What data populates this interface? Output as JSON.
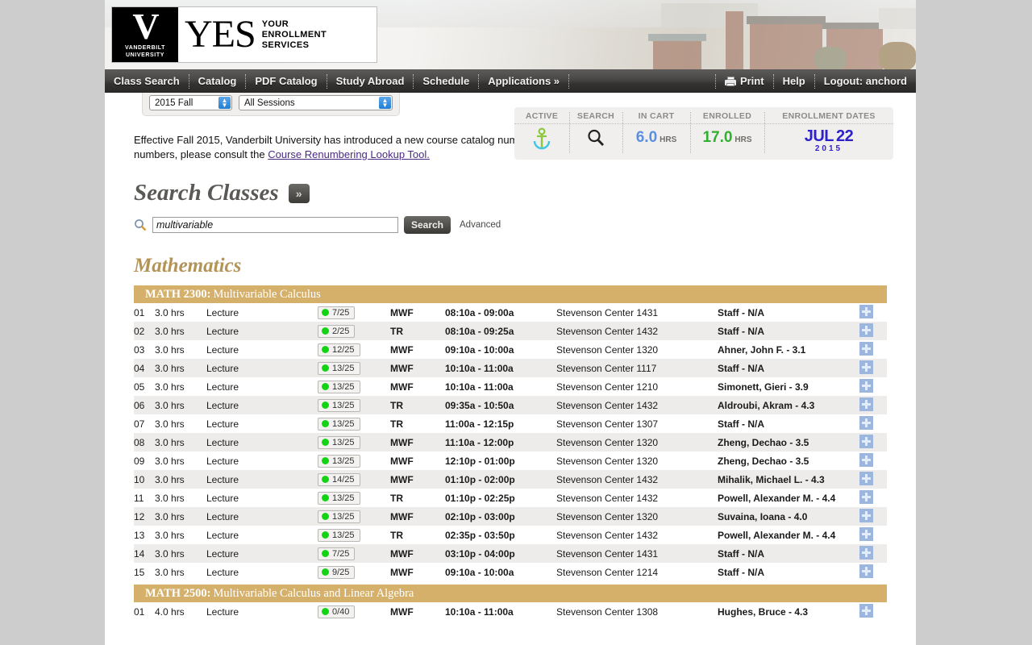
{
  "brand": {
    "university_line1": "VANDERBILT",
    "university_line2": "UNIVERSITY",
    "yes": "YES",
    "tagline_1": "YOUR",
    "tagline_2": "ENROLLMENT",
    "tagline_3": "SERVICES"
  },
  "nav": {
    "left_items": [
      "Class Search",
      "Catalog",
      "PDF Catalog",
      "Study Abroad",
      "Schedule",
      "Applications »"
    ],
    "print": "Print",
    "help": "Help",
    "logout": "Logout: anchord"
  },
  "term_bar": {
    "term": "2015 Fall",
    "session": "All Sessions"
  },
  "status": {
    "active_label": "ACTIVE",
    "search_label": "SEARCH",
    "cart_label": "IN CART",
    "cart_value": "6.0",
    "cart_units": "HRS",
    "cart_color": "#5b8fe0",
    "enrolled_label": "ENROLLED",
    "enrolled_value": "17.0",
    "enrolled_units": "HRS",
    "enrolled_color": "#2fb02f",
    "dates_label": "ENROLLMENT DATES",
    "dates_month": "JUL",
    "dates_day": "22",
    "dates_year": "2015"
  },
  "notice": {
    "text_before": "Effective Fall 2015, Vanderbilt University has introduced a new course catalog numbering scheme. For assistance with the translation between old and new numbers, please consult the ",
    "link": "Course Renumbering Lookup Tool."
  },
  "search": {
    "heading": "Search Classes",
    "expand_button": "»",
    "input_value": "multivariable",
    "button_label": "Search",
    "advanced_label": "Advanced"
  },
  "department": "Mathematics",
  "courses": [
    {
      "code": "MATH 2300:",
      "title": "Multivariable Calculus",
      "sections": [
        {
          "sec": "01",
          "hrs": "3.0 hrs",
          "type": "Lecture",
          "avail": "7/25",
          "days": "MWF",
          "time": "08:10a - 09:00a",
          "loc": "Stevenson Center 1431",
          "instructor": "Staff - N/A",
          "rating_color": "dark"
        },
        {
          "sec": "02",
          "hrs": "3.0 hrs",
          "type": "Lecture",
          "avail": "2/25",
          "days": "TR",
          "time": "08:10a - 09:25a",
          "loc": "Stevenson Center 1432",
          "instructor": "Staff - N/A",
          "rating_color": "dark"
        },
        {
          "sec": "03",
          "hrs": "3.0 hrs",
          "type": "Lecture",
          "avail": "12/25",
          "days": "MWF",
          "time": "09:10a - 10:00a",
          "loc": "Stevenson Center 1320",
          "instructor": "Ahner, John F. - 3.1",
          "rating_color": "orange"
        },
        {
          "sec": "04",
          "hrs": "3.0 hrs",
          "type": "Lecture",
          "avail": "13/25",
          "days": "MWF",
          "time": "10:10a - 11:00a",
          "loc": "Stevenson Center 1117",
          "instructor": "Staff - N/A",
          "rating_color": "dark"
        },
        {
          "sec": "05",
          "hrs": "3.0 hrs",
          "type": "Lecture",
          "avail": "13/25",
          "days": "MWF",
          "time": "10:10a - 11:00a",
          "loc": "Stevenson Center 1210",
          "instructor": "Simonett, Gieri - 3.9",
          "rating_color": "orange"
        },
        {
          "sec": "06",
          "hrs": "3.0 hrs",
          "type": "Lecture",
          "avail": "13/25",
          "days": "TR",
          "time": "09:35a - 10:50a",
          "loc": "Stevenson Center 1432",
          "instructor": "Aldroubi, Akram - 4.3",
          "rating_color": "green"
        },
        {
          "sec": "07",
          "hrs": "3.0 hrs",
          "type": "Lecture",
          "avail": "13/25",
          "days": "TR",
          "time": "11:00a - 12:15p",
          "loc": "Stevenson Center 1307",
          "instructor": "Staff - N/A",
          "rating_color": "dark"
        },
        {
          "sec": "08",
          "hrs": "3.0 hrs",
          "type": "Lecture",
          "avail": "13/25",
          "days": "MWF",
          "time": "11:10a - 12:00p",
          "loc": "Stevenson Center 1320",
          "instructor": "Zheng, Dechao - 3.5",
          "rating_color": "orange"
        },
        {
          "sec": "09",
          "hrs": "3.0 hrs",
          "type": "Lecture",
          "avail": "13/25",
          "days": "MWF",
          "time": "12:10p - 01:00p",
          "loc": "Stevenson Center 1320",
          "instructor": "Zheng, Dechao - 3.5",
          "rating_color": "orange"
        },
        {
          "sec": "10",
          "hrs": "3.0 hrs",
          "type": "Lecture",
          "avail": "14/25",
          "days": "MWF",
          "time": "01:10p - 02:00p",
          "loc": "Stevenson Center 1432",
          "instructor": "Mihalik, Michael L. - 4.3",
          "rating_color": "green"
        },
        {
          "sec": "11",
          "hrs": "3.0 hrs",
          "type": "Lecture",
          "avail": "13/25",
          "days": "TR",
          "time": "01:10p - 02:25p",
          "loc": "Stevenson Center 1432",
          "instructor": "Powell, Alexander M. - 4.4",
          "rating_color": "green"
        },
        {
          "sec": "12",
          "hrs": "3.0 hrs",
          "type": "Lecture",
          "avail": "13/25",
          "days": "MWF",
          "time": "02:10p - 03:00p",
          "loc": "Stevenson Center 1320",
          "instructor": "Suvaina, Ioana - 4.0",
          "rating_color": "green"
        },
        {
          "sec": "13",
          "hrs": "3.0 hrs",
          "type": "Lecture",
          "avail": "13/25",
          "days": "TR",
          "time": "02:35p - 03:50p",
          "loc": "Stevenson Center 1432",
          "instructor": "Powell, Alexander M. - 4.4",
          "rating_color": "green"
        },
        {
          "sec": "14",
          "hrs": "3.0 hrs",
          "type": "Lecture",
          "avail": "7/25",
          "days": "MWF",
          "time": "03:10p - 04:00p",
          "loc": "Stevenson Center 1431",
          "instructor": "Staff - N/A",
          "rating_color": "dark"
        },
        {
          "sec": "15",
          "hrs": "3.0 hrs",
          "type": "Lecture",
          "avail": "9/25",
          "days": "MWF",
          "time": "09:10a - 10:00a",
          "loc": "Stevenson Center 1214",
          "instructor": "Staff - N/A",
          "rating_color": "dark"
        }
      ]
    },
    {
      "code": "MATH 2500:",
      "title": "Multivariable Calculus and Linear Algebra",
      "sections": [
        {
          "sec": "01",
          "hrs": "4.0 hrs",
          "type": "Lecture",
          "avail": "0/40",
          "days": "MWF",
          "time": "10:10a - 11:00a",
          "loc": "Stevenson Center 1308",
          "instructor": "Hughes, Bruce - 4.3",
          "rating_color": "green"
        }
      ]
    }
  ]
}
